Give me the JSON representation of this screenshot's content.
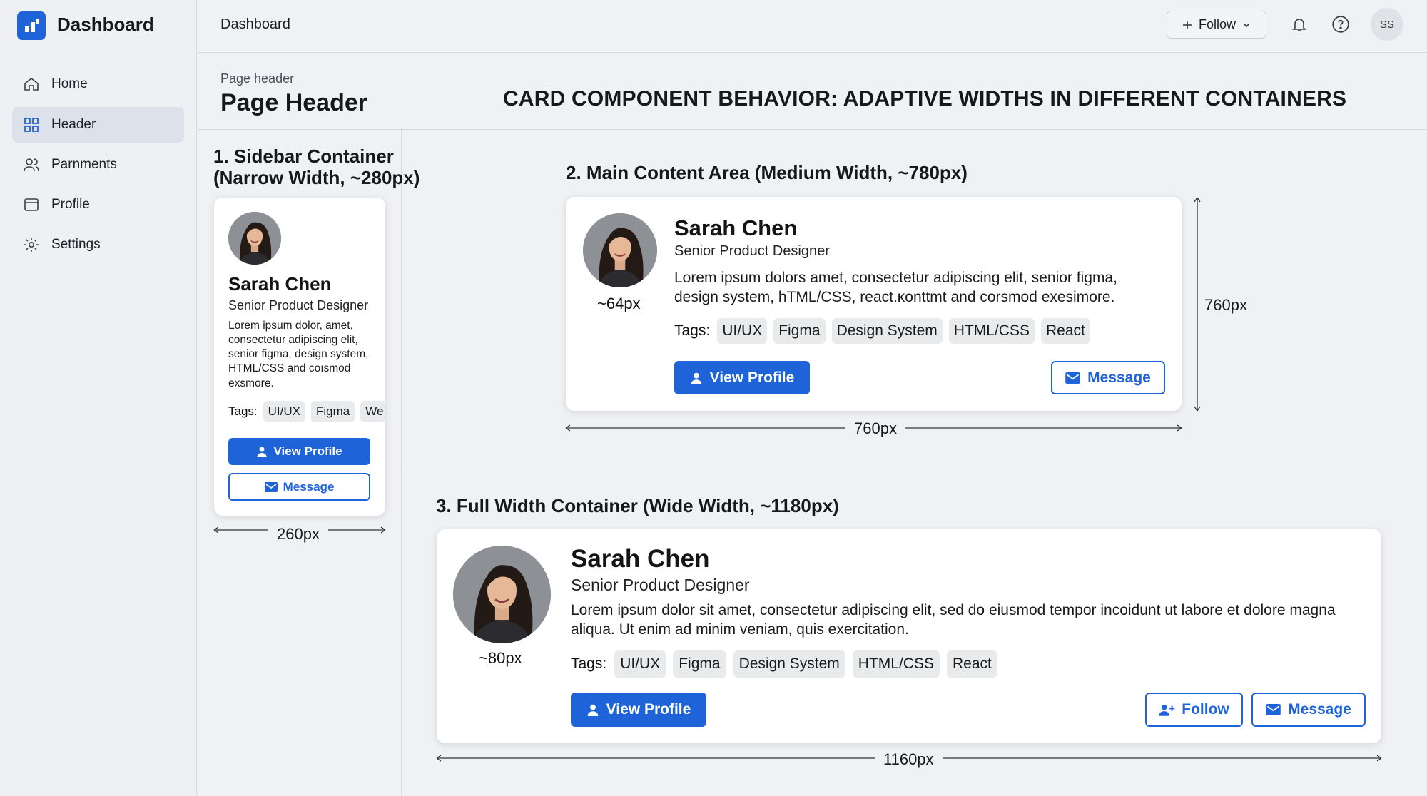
{
  "app": {
    "title": "Dashboard"
  },
  "sidebar": {
    "items": [
      {
        "label": "Home",
        "icon": "home-icon"
      },
      {
        "label": "Header",
        "icon": "grid-icon",
        "active": true
      },
      {
        "label": "Parnments",
        "icon": "users-icon"
      },
      {
        "label": "Profile",
        "icon": "window-icon"
      },
      {
        "label": "Settings",
        "icon": "gear-icon"
      }
    ]
  },
  "topbar": {
    "title": "Dashboard",
    "follow_label": "Follow",
    "avatar_initials": "SS"
  },
  "page": {
    "header_small": "Page header",
    "header_big": "Page Header",
    "heading": "CARD COMPONENT BEHAVIOR: ADAPTIVE WIDTHS IN DIFFERENT CONTAINERS"
  },
  "colors": {
    "accent": "#1f63d8",
    "background": "#eff1f4",
    "card": "#ffffff",
    "tag": "#e9eaec"
  },
  "sections": [
    {
      "title_line1": "1. Sidebar Container",
      "title_line2": "(Narrow Width, ~280px)",
      "width_label": "260px",
      "card": {
        "name": "Sarah Chen",
        "role": "Senior Product Designer",
        "bio": "Lorem ipsum dolor, amet, consectetur adipiscing elit, senior figma, design system, HTML/CSS and coısmod exsmore.",
        "tags_label": "Tags:",
        "tags": [
          "UI/UX",
          "Figma",
          "We"
        ],
        "view_profile": "View Profile",
        "message": "Message"
      }
    },
    {
      "title": "2. Main Content Area (Medium Width, ~780px)",
      "width_label": "760px",
      "height_label": "760px",
      "avatar_label": "~64px",
      "card": {
        "name": "Sarah Chen",
        "role": "Senior Product Designer",
        "bio": "Lorem ipsum dolors amet, consectetur adipiscing elit, senior figma, design system, hTML/CSS, react.ĸonttmt and corsmod exesimore.",
        "tags_label": "Tags:",
        "tags": [
          "UI/UX",
          "Figma",
          "Design System",
          "HTML/CSS",
          "React"
        ],
        "view_profile": "View Profile",
        "message": "Message"
      }
    },
    {
      "title": "3. Full Width Container (Wide Width, ~1180px)",
      "width_label": "1160px",
      "avatar_label": "~80px",
      "card": {
        "name": "Sarah Chen",
        "role": "Senior Product Designer",
        "bio": "Lorem ipsum dolor sit amet, consectetur adipiscing elit, sed do eiusmod tempor incoidunt ut labore et dolore magna aliqua. Ut enim ad minim veniam, quis exercitation.",
        "tags_label": "Tags:",
        "tags": [
          "UI/UX",
          "Figma",
          "Design System",
          "HTML/CSS",
          "React"
        ],
        "view_profile": "View Profile",
        "follow": "Follow",
        "message": "Message"
      }
    }
  ]
}
